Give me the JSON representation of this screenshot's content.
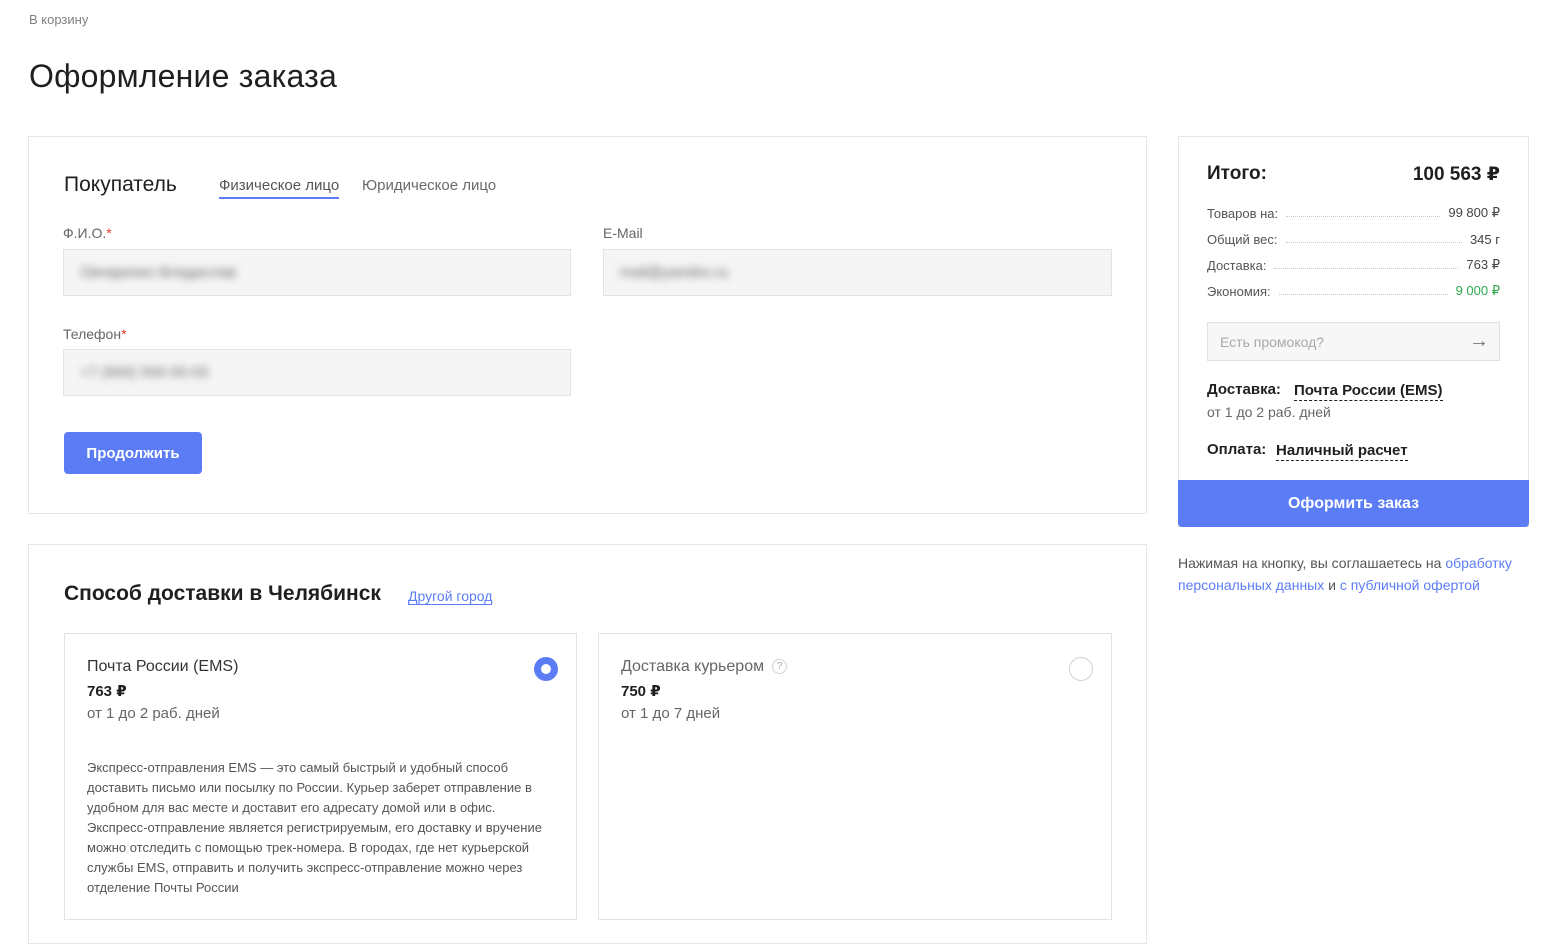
{
  "nav": {
    "back_label": "В корзину"
  },
  "page": {
    "title": "Оформление заказа"
  },
  "buyer": {
    "title": "Покупатель",
    "tabs": [
      {
        "label": "Физическое лицо",
        "active": true
      },
      {
        "label": "Юридическое лицо",
        "active": false
      }
    ],
    "fields": {
      "fio": {
        "label": "Ф.И.О.",
        "required_mark": "*",
        "value": "Овчаренко Владислав"
      },
      "email": {
        "label": "E-Mail",
        "value": "mail@yandex.ru"
      },
      "phone": {
        "label": "Телефон",
        "required_mark": "*",
        "value": "+7 (900) 555-55-55"
      }
    },
    "continue_label": "Продолжить"
  },
  "delivery": {
    "title": "Способ доставки в Челябинск",
    "other_city_label": "Другой город",
    "options": [
      {
        "name": "Почта России (EMS)",
        "price": "763 ₽",
        "term": "от 1 до 2 раб. дней",
        "selected": true,
        "description": "Экспресс-отправления EMS — это самый быстрый и удобный способ доставить письмо или посылку по России. Курьер заберет отправление в удобном для вас месте и доставит его адресату домой или в офис. Экспресс-отправление является регистрируемым, его доставку и вручение можно отследить с помощью трек-номера. В городах, где нет курьерской службы EMS, отправить и получить экспресс-отправление можно через отделение Почты России"
      },
      {
        "name": "Доставка курьером",
        "help_icon": "?",
        "price": "750 ₽",
        "term": "от 1 до 7 дней",
        "selected": false
      }
    ]
  },
  "summary": {
    "title": "Итого:",
    "total": "100 563 ₽",
    "rows": [
      {
        "label": "Товаров на:",
        "value": "99 800 ₽"
      },
      {
        "label": "Общий вес:",
        "value": "345 г"
      },
      {
        "label": "Доставка:",
        "value": "763 ₽"
      },
      {
        "label": "Экономия:",
        "value": "9 000 ₽"
      }
    ],
    "promo_placeholder": "Есть промокод?",
    "delivery_label": "Доставка:",
    "delivery_value": "Почта России (EMS)",
    "delivery_term": "от 1 до 2 раб. дней",
    "payment_label": "Оплата:",
    "payment_value": "Наличный расчет",
    "order_button": "Оформить заказ"
  },
  "agreement": {
    "text_before": "Нажимая на кнопку, вы соглашаетесь на ",
    "link_personal": "обработку персональных данных",
    "text_middle": " и ",
    "link_offer": "с публичной офертой"
  },
  "colors": {
    "accent": "#5b7cf5",
    "saving": "#2fa84f",
    "required": "#e53935"
  },
  "icons": {
    "promo_submit": "arrow-right-icon",
    "delivery_help": "question-icon"
  }
}
